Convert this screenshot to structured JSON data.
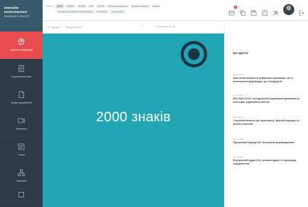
{
  "logo": {
    "title": "ОНЛАЙН-КОНСУЛЬТАНТ",
    "subtitle": "ФАХІВЦЯ З ЯКОСТІ"
  },
  "sidebar": {
    "items": [
      {
        "label": "Запити консультації",
        "icon": "chat-icon",
        "active": true
      },
      {
        "label": "Нормативна база",
        "icon": "document-icon",
        "active": false
      },
      {
        "label": "Зразки документів",
        "icon": "file-icon",
        "active": false
      },
      {
        "label": "Навчання",
        "icon": "video-icon",
        "active": false
      },
      {
        "label": "Статті",
        "icon": "article-icon",
        "active": false
      },
      {
        "label": "Офіційне",
        "icon": "org-icon",
        "active": false
      }
    ]
  },
  "topbar": {
    "filters_row1": [
      "Всього",
      "ДСТУ",
      "ISO/IEC",
      "EN ISO",
      "ISO",
      "ISO/TS",
      "Технічні регламенти",
      "Державні кодекси",
      "Норми"
    ],
    "filters_row2": [
      "Нормативні документи Мінекономіки",
      "Постанови",
      "Інші рішення"
    ],
    "notification_count": "3"
  },
  "searchbar": {
    "label": "Шукати",
    "placeholder": "Введіть запит",
    "sort_label": "Сортувати за"
  },
  "main": {
    "text": "2000 знаків",
    "accent": "#22a5b4",
    "icon": "target-icon"
  },
  "right_panel": {
    "heading": "НА ЦЕСТУ",
    "news": [
      {
        "date": "00.00.0000",
        "title": "Змістовні вимоги в управлінні ризиками: як їх виконувати відповідно до стандартів"
      },
      {
        "date": "00.00.0000",
        "title": "ISO 9001:2015: методологія управління ризиками в системах управління якістю"
      },
      {
        "date": "00.00.0000",
        "title": "Службові вимоги до персоналу: фахові підходи та аналіз помилок"
      },
      {
        "date": "00.00.0000",
        "title": "Процесний підхід ISO: алгоритм впровадження"
      },
      {
        "date": "00.00.0000",
        "title": "Внутрішній аудит ISO: рекомендації та приклади оформлення"
      }
    ]
  },
  "colors": {
    "sidebar_bg": "#2e3a46",
    "active_red": "#e74c4f",
    "panel_teal": "#22a5b4",
    "logo_bg": "#35596a"
  }
}
